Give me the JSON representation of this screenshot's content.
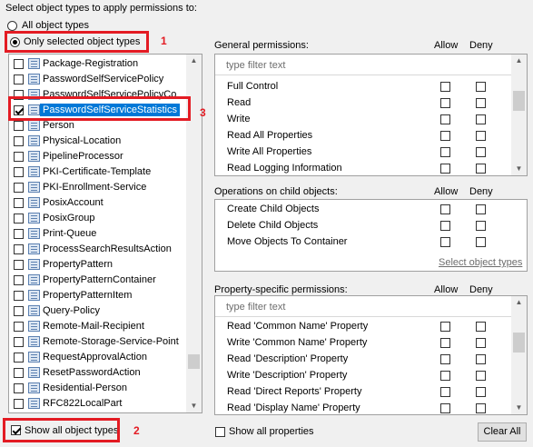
{
  "header": {
    "prompt": "Select object types to apply permissions to:"
  },
  "scope": {
    "all_label": "All object types",
    "only_label": "Only selected object types"
  },
  "object_types": [
    {
      "label": "Package-Registration",
      "checked": false
    },
    {
      "label": "PasswordSelfServicePolicy",
      "checked": false
    },
    {
      "label": "PasswordSelfServicePolicyCo",
      "checked": false
    },
    {
      "label": "PasswordSelfServiceStatistics",
      "checked": true
    },
    {
      "label": "Person",
      "checked": false
    },
    {
      "label": "Physical-Location",
      "checked": false
    },
    {
      "label": "PipelineProcessor",
      "checked": false
    },
    {
      "label": "PKI-Certificate-Template",
      "checked": false
    },
    {
      "label": "PKI-Enrollment-Service",
      "checked": false
    },
    {
      "label": "PosixAccount",
      "checked": false
    },
    {
      "label": "PosixGroup",
      "checked": false
    },
    {
      "label": "Print-Queue",
      "checked": false
    },
    {
      "label": "ProcessSearchResultsAction",
      "checked": false
    },
    {
      "label": "PropertyPattern",
      "checked": false
    },
    {
      "label": "PropertyPatternContainer",
      "checked": false
    },
    {
      "label": "PropertyPatternItem",
      "checked": false
    },
    {
      "label": "Query-Policy",
      "checked": false
    },
    {
      "label": "Remote-Mail-Recipient",
      "checked": false
    },
    {
      "label": "Remote-Storage-Service-Point",
      "checked": false
    },
    {
      "label": "RequestApprovalAction",
      "checked": false
    },
    {
      "label": "ResetPasswordAction",
      "checked": false
    },
    {
      "label": "Residential-Person",
      "checked": false
    },
    {
      "label": "RFC822LocalPart",
      "checked": false
    }
  ],
  "show_all": {
    "label": "Show all object types",
    "checked": true
  },
  "annotations": {
    "n1": "1",
    "n2": "2",
    "n3": "3"
  },
  "columns": {
    "allow": "Allow",
    "deny": "Deny"
  },
  "general": {
    "title": "General permissions:",
    "filter_placeholder": "type filter text",
    "items": [
      "Full Control",
      "Read",
      "Write",
      "Read All Properties",
      "Write All Properties",
      "Read Logging Information"
    ]
  },
  "child_ops": {
    "title": "Operations on child objects:",
    "items": [
      "Create Child Objects",
      "Delete Child Objects",
      "Move Objects To Container"
    ],
    "link": "Select object types"
  },
  "property": {
    "title": "Property-specific permissions:",
    "filter_placeholder": "type filter text",
    "items": [
      "Read 'Common Name' Property",
      "Write 'Common Name' Property",
      "Read 'Description' Property",
      "Write 'Description' Property",
      "Read 'Direct Reports' Property",
      "Read 'Display Name' Property"
    ]
  },
  "footer": {
    "show_all_props": "Show all properties",
    "clear_all": "Clear All"
  },
  "colors": {
    "annotation": "#e31b23",
    "selection": "#0078d7"
  }
}
